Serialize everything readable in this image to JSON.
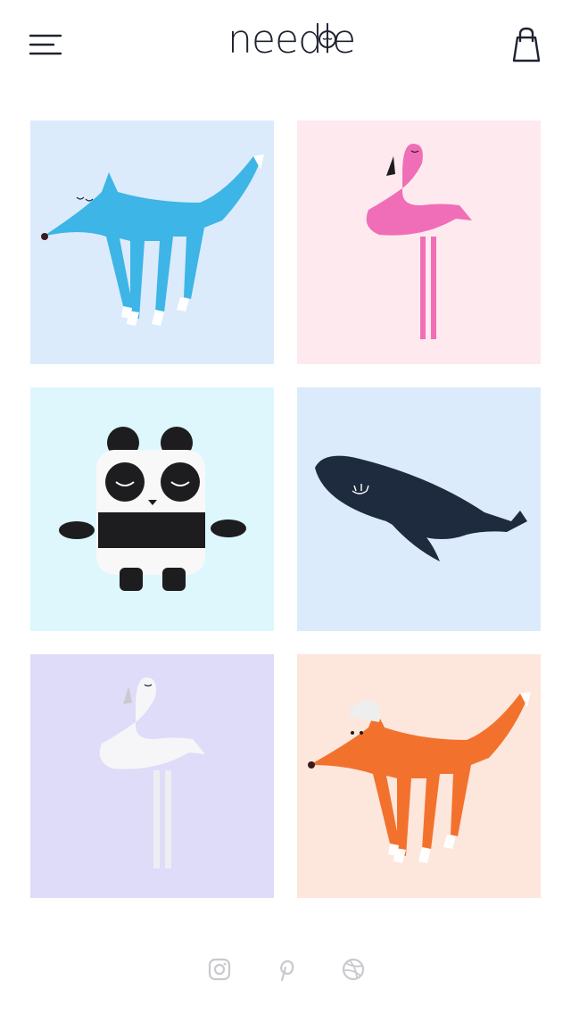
{
  "app": {
    "logo_text": "needle"
  },
  "header": {
    "menu_icon": "hamburger-menu-icon",
    "cart_icon": "shopping-bag-icon"
  },
  "products": [
    {
      "name": "blue-fox",
      "bg": "#dcebfb",
      "color": "#3db5e6"
    },
    {
      "name": "pink-flamingo",
      "bg": "#fde9ee",
      "color": "#f06eb7"
    },
    {
      "name": "panda",
      "bg": "#ddf7fd",
      "color": "#1d1d1f"
    },
    {
      "name": "whale",
      "bg": "#dcebfb",
      "color": "#1e2a3d"
    },
    {
      "name": "white-flamingo",
      "bg": "#dedcf9",
      "color": "#f3f3f5"
    },
    {
      "name": "orange-fox",
      "bg": "#fde6dc",
      "color": "#f2722d"
    }
  ],
  "social": [
    {
      "icon": "instagram-icon"
    },
    {
      "icon": "pinterest-icon"
    },
    {
      "icon": "dribbble-icon"
    }
  ],
  "colors": {
    "text": "#1f2330",
    "social": "#c9c9cf"
  }
}
